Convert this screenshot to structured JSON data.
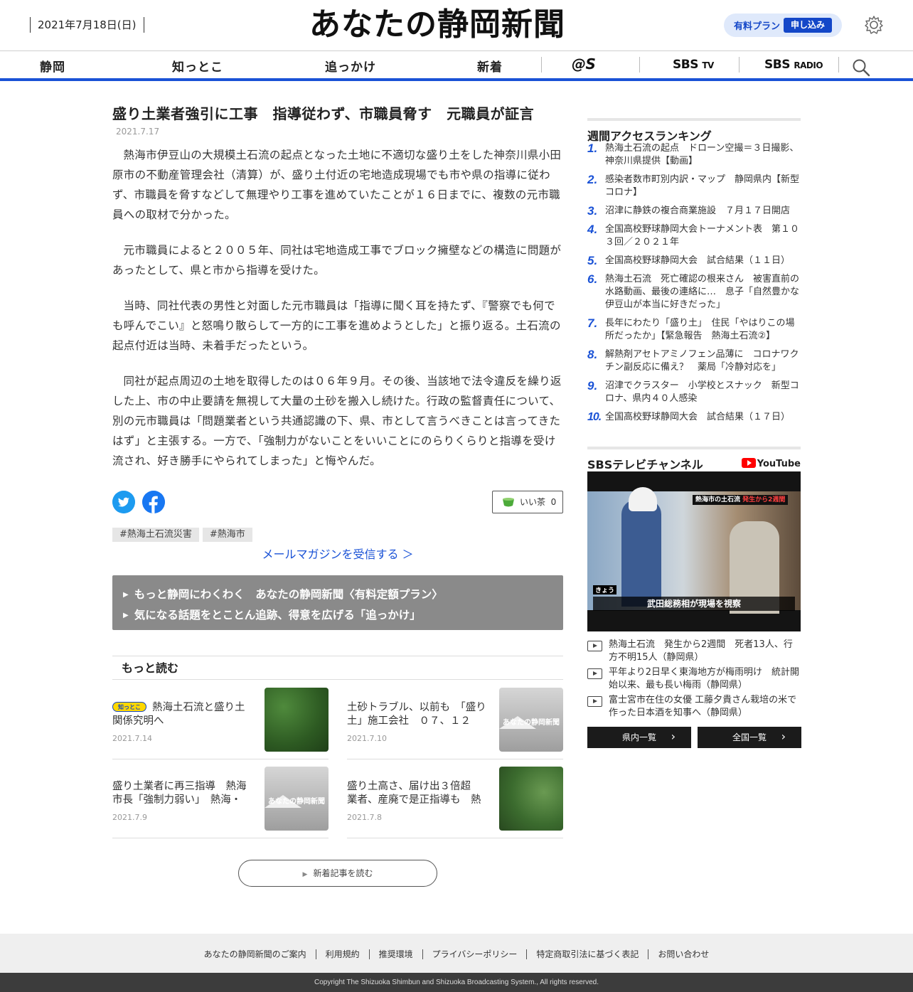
{
  "header": {
    "date": "2021年7月18日(日)",
    "logo": "あなたの静岡新聞",
    "plan_label": "有料プラン",
    "plan_button": "申し込み",
    "settings_icon": "gear-icon"
  },
  "nav": {
    "items": [
      "静岡",
      "知っとこ",
      "追っかけ",
      "新着"
    ],
    "at_s": "@S",
    "sbs_tv": "SBS",
    "sbs_tv_sub": "TV",
    "sbs_radio": "SBS",
    "sbs_radio_sub": "RADIO",
    "search_icon": "search-icon"
  },
  "article": {
    "title": "盛り土業者強引に工事　指導従わず、市職員脅す　元職員が証言",
    "date": "2021.7.17",
    "paragraphs": [
      "熱海市伊豆山の大規模土石流の起点となった土地に不適切な盛り土をした神奈川県小田原市の不動産管理会社（清算）が、盛り土付近の宅地造成現場でも市や県の指導に従わず、市職員を脅すなどして無理やり工事を進めていたことが１６日までに、複数の元市職員への取材で分かった。",
      "元市職員によると２００５年、同社は宅地造成工事でブロック擁壁などの構造に問題があったとして、県と市から指導を受けた。",
      "当時、同社代表の男性と対面した元市職員は「指導に聞く耳を持たず、『警察でも何でも呼んでこい』と怒鳴り散らして一方的に工事を進めようとした」と振り返る。土石流の起点付近は当時、未着手だったという。",
      "同社が起点周辺の土地を取得したのは０６年９月。その後、当該地で法令違反を繰り返した上、市の中止要請を無視して大量の土砂を搬入し続けた。行政の監督責任について、別の元市職員は「問題業者という共通認識の下、県、市として言うべきことは言ってきたはず」と主張する。一方で、「強制力がないことをいいことにのらりくらりと指導を受け流され、好き勝手にやられてしまった」と悔やんだ。"
    ],
    "tea_label": "いい茶",
    "tea_count": "0",
    "tags": [
      "#熱海土石流災害",
      "#熱海市"
    ],
    "mail_link": "メールマガジンを受信する ＞",
    "promo": [
      "もっと静岡にわくわく　あなたの静岡新聞〈有料定額プラン〉",
      "気になる話題をとことん追跡、得意を広げる「追っかけ」"
    ]
  },
  "more": {
    "heading": "もっと読む",
    "badge": "知っとこ",
    "cards": [
      {
        "title": "熱海土石流と盛り土　関係究明へ",
        "date": "2021.7.14"
      },
      {
        "title": "土砂トラブル、以前も　「盛り土」施工会社　０７、１２年…",
        "date": "2021.7.10"
      },
      {
        "title": "盛り土業者に再三指導　熱海市長「強制力弱い」　熱海・土…",
        "date": "2021.7.9"
      },
      {
        "title": "盛り土高さ、届け出３倍超　業者、産廃で是正指導も　熱海…",
        "date": "2021.7.8"
      }
    ],
    "placeholder_text": "あなたの静岡新聞",
    "new_articles": "新着記事を読む"
  },
  "ranking": {
    "heading": "週間アクセスランキング",
    "items": [
      {
        "n": "1.",
        "t": "熱海土石流の起点　ドローン空撮＝３日撮影、神奈川県提供【動画】"
      },
      {
        "n": "2.",
        "t": "感染者数市町別内訳・マップ　静岡県内【新型コロナ】"
      },
      {
        "n": "3.",
        "t": "沼津に静鉄の複合商業施設　７月１７日開店"
      },
      {
        "n": "4.",
        "t": "全国高校野球静岡大会トーナメント表　第１０３回／２０２１年"
      },
      {
        "n": "5.",
        "t": "全国高校野球静岡大会　試合結果（１１日）"
      },
      {
        "n": "6.",
        "t": "熱海土石流　死亡確認の根来さん　被害直前の水路動画、最後の連絡に…　息子「自然豊かな伊豆山が本当に好きだった」"
      },
      {
        "n": "7.",
        "t": "長年にわたり「盛り土」　住民「やはりこの場所だったか」【緊急報告　熱海土石流②】"
      },
      {
        "n": "8.",
        "t": "解熱剤アセトアミノフェン品薄に　コロナワクチン副反応に備え？　薬局「冷静対応を」"
      },
      {
        "n": "9.",
        "t": "沼津でクラスター　小学校とスナック　新型コロナ、県内４０人感染"
      },
      {
        "n": "10.",
        "t": "全国高校野球静岡大会　試合結果（１７日）"
      }
    ]
  },
  "sbs": {
    "heading": "SBSテレビチャンネル",
    "youtube": "YouTube",
    "video_caption_top": "熱海市の土石流",
    "video_caption_top_accent": "発生から2週間",
    "video_kyo": "きょう",
    "video_caption_bottom": "武田総務相が現場を視察",
    "videos": [
      "熱海土石流　発生から2週間　死者13人、行方不明15人（静岡県）",
      "平年より2日早く東海地方が梅雨明け　統計開始以来、最も長い梅雨（静岡県）",
      "富士宮市在住の女優 工藤夕貴さん栽培の米で作った日本酒を知事へ（静岡県）"
    ],
    "btn_local": "県内一覧",
    "btn_national": "全国一覧"
  },
  "footer": {
    "links": [
      "あなたの静岡新聞のご案内",
      "利用規約",
      "推奨環境",
      "プライバシーポリシー",
      "特定商取引法に基づく表記",
      "お問い合わせ"
    ],
    "copyright": "Copyright The Shizuoka Shimbun and Shizuoka Broadcasting System., All rights reserved."
  }
}
